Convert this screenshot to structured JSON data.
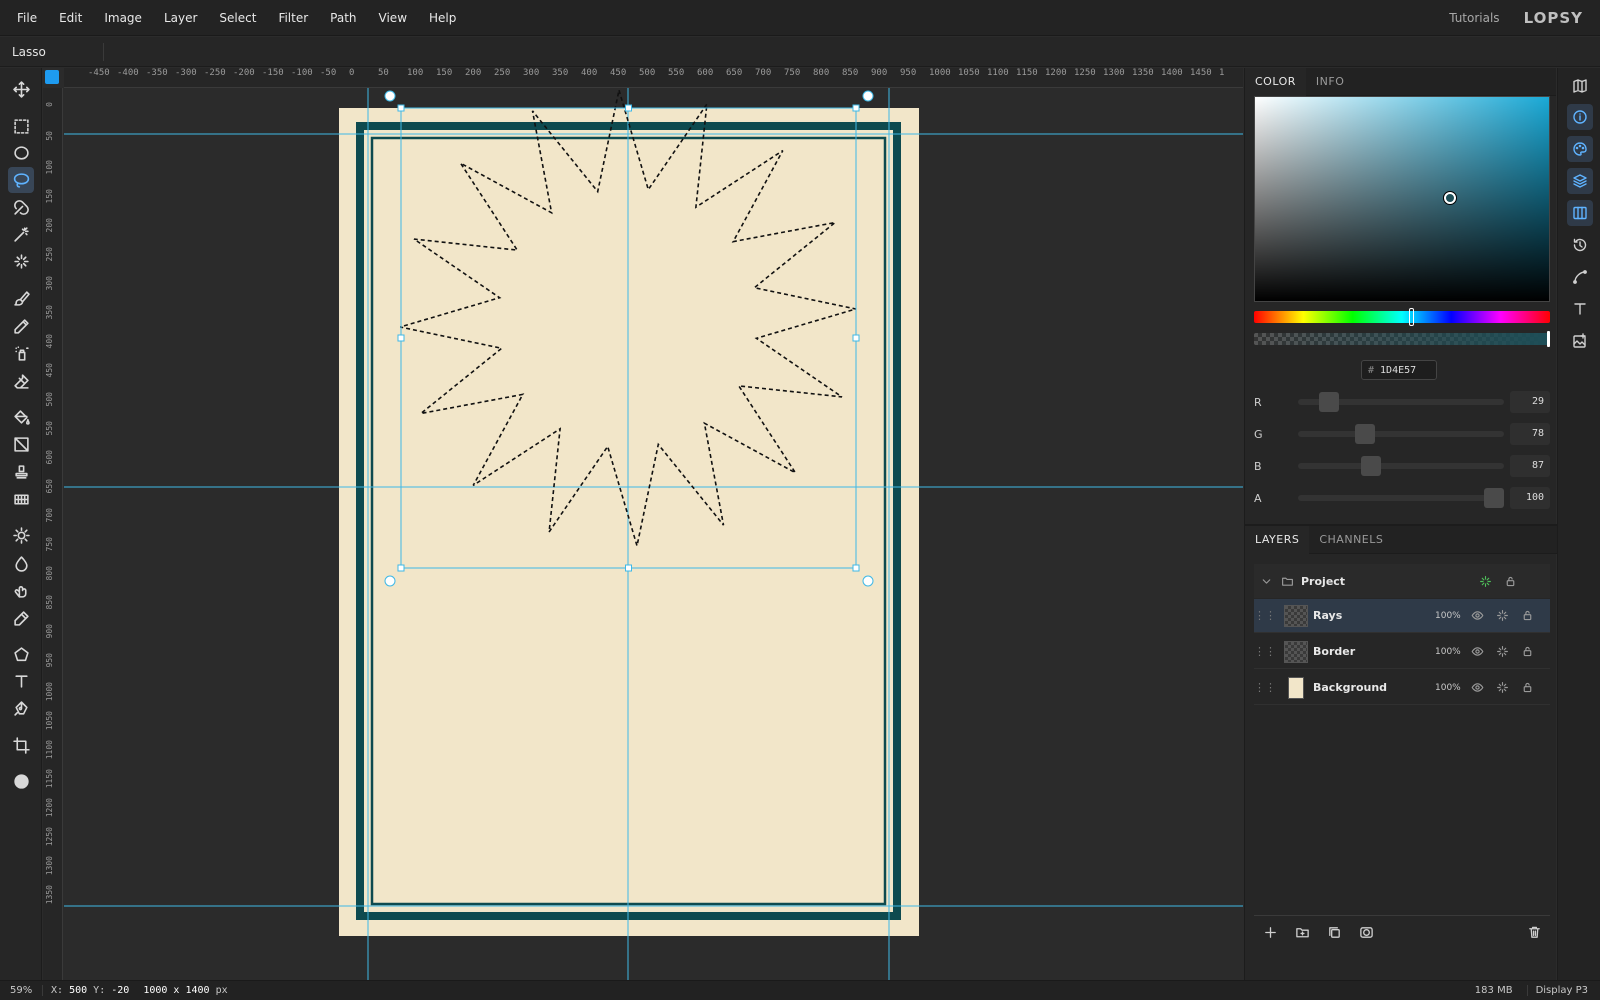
{
  "menu": {
    "items": [
      "File",
      "Edit",
      "Image",
      "Layer",
      "Select",
      "Filter",
      "Path",
      "View",
      "Help"
    ],
    "tutorials": "Tutorials",
    "logo": "LOPSY"
  },
  "options": {
    "tool_name": "Lasso"
  },
  "toolbox": {
    "tools": [
      {
        "icon": "move-icon"
      },
      {
        "icon": "rect-select-icon"
      },
      {
        "icon": "ellipse-select-icon"
      },
      {
        "icon": "lasso-icon",
        "active": true
      },
      {
        "icon": "magnetic-lasso-icon"
      },
      {
        "icon": "magic-wand-icon"
      },
      {
        "icon": "quick-select-icon"
      },
      {
        "icon": "brush-icon"
      },
      {
        "icon": "pencil-icon"
      },
      {
        "icon": "spray-icon"
      },
      {
        "icon": "eraser-icon"
      },
      {
        "icon": "paint-bucket-icon"
      },
      {
        "icon": "gradient-icon"
      },
      {
        "icon": "stamp-icon"
      },
      {
        "icon": "pattern-icon"
      },
      {
        "icon": "dodge-icon"
      },
      {
        "icon": "blur-icon"
      },
      {
        "icon": "smudge-icon"
      },
      {
        "icon": "eyedropper-icon"
      },
      {
        "icon": "shape-icon"
      },
      {
        "icon": "text-icon"
      },
      {
        "icon": "pen-icon"
      },
      {
        "icon": "crop-icon"
      },
      {
        "icon": "color-swap-icon"
      }
    ]
  },
  "rulers": {
    "horizontal": [
      "-450",
      "-400",
      "-350",
      "-300",
      "-250",
      "-200",
      "-150",
      "-100",
      "-50",
      "0",
      "50",
      "100",
      "150",
      "200",
      "250",
      "300",
      "350",
      "400",
      "450",
      "500",
      "550",
      "600",
      "650",
      "700",
      "750",
      "800",
      "850",
      "900",
      "950",
      "1000",
      "1050",
      "1100",
      "1150",
      "1200",
      "1250",
      "1300",
      "1350",
      "1400",
      "1450",
      "1"
    ],
    "vertical": [
      "0",
      "50",
      "100",
      "150",
      "200",
      "250",
      "300",
      "350",
      "400",
      "450",
      "500",
      "550",
      "600",
      "650",
      "700",
      "750",
      "800",
      "850",
      "900",
      "950",
      "1000",
      "1050",
      "1100",
      "1150",
      "1200",
      "1250",
      "1300",
      "1350"
    ]
  },
  "canvas": {
    "page_color": "#f2e6c9",
    "border_color": "#0e4a4f",
    "guide_color": "#3fb8e6",
    "selection_points": 16
  },
  "color_panel": {
    "tabs": [
      "COLOR",
      "INFO"
    ],
    "hex_value": "1D4E57",
    "hue_color": "#1aa9d6",
    "current_color": "#1D4E57",
    "channels": [
      {
        "label": "R",
        "value": "29",
        "fraction": 0.114
      },
      {
        "label": "G",
        "value": "78",
        "fraction": 0.306
      },
      {
        "label": "B",
        "value": "87",
        "fraction": 0.341
      },
      {
        "label": "A",
        "value": "100",
        "fraction": 1.0
      }
    ],
    "hue_position": 0.53,
    "picker_position": {
      "s": 0.66,
      "v": 0.51
    }
  },
  "layers_panel": {
    "tabs": [
      "LAYERS",
      "CHANNELS"
    ],
    "group_name": "Project",
    "layers": [
      {
        "name": "Rays",
        "opacity": "100%",
        "active": true
      },
      {
        "name": "Border",
        "opacity": "100%"
      },
      {
        "name": "Background",
        "opacity": "100%",
        "bg": true
      }
    ]
  },
  "status": {
    "zoom": "59%",
    "coords_label_x": "X:",
    "coords_x": "500",
    "coords_label_y": "Y:",
    "coords_y": "-20",
    "dims": "1000 x 1400",
    "dims_unit": "px",
    "memory": "183 MB",
    "profile": "Display P3"
  }
}
